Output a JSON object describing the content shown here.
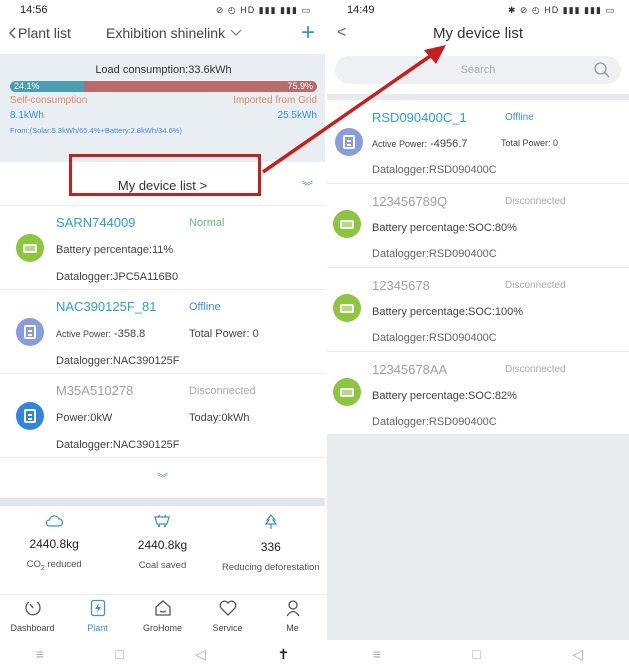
{
  "left": {
    "status_time": "14:56",
    "status_icons": "⊘ ◴ HD ▮▮▮ ▮▮▮ ▭",
    "back_label": "Plant list",
    "plant_name": "Exhibition shinelink",
    "plus": "+",
    "load": {
      "title": "Load consumption:33.6kWh",
      "self_pct": "24.1%",
      "grid_pct": "75.9%",
      "self_label": "Self-consumption",
      "grid_label": "Imported from Grid",
      "self_value": "8.1kWh",
      "grid_value": "25.5kWh",
      "from": "From:(Solar:5.3kWh/65.4%+Battery:2.8kWh/34.6%)",
      "bar_fraction_self": 0.241
    },
    "my_device_list": "My device list >",
    "devices": [
      {
        "name": "SARN744009",
        "status": "Normal",
        "status_color": "#5cc070",
        "icon": "battery-icon",
        "line1": "Battery percentage:11%",
        "line1b": "",
        "line2": "Datalogger:JPC5A116B0"
      },
      {
        "name": "NAC390125F_81",
        "status": "Offline",
        "status_color": "#3a8ee6",
        "icon": "inverter-icon",
        "line1_label": "Active Power:",
        "line1_value": "-358.8",
        "line1b": "Total Power: 0",
        "line2": "Datalogger:NAC390125F"
      },
      {
        "name": "M35A510278",
        "status": "Disconnected",
        "status_color": "#aaaaaa",
        "icon": "meter-icon",
        "line1": "Power:0kW",
        "line1b": "Today:0kWh",
        "line2": "Datalogger:NAC390125F"
      }
    ],
    "eco": [
      {
        "value": "2440.8kg",
        "label_main": "CO",
        "label_sub": "2",
        "label_rest": " reduced"
      },
      {
        "value": "2440.8kg",
        "label": "Coal saved"
      },
      {
        "value": "336",
        "label": "Reducing deforestation"
      }
    ],
    "tabs": [
      "Dashboard",
      "Plant",
      "GroHome",
      "Service",
      "Me"
    ],
    "nav": [
      "≡",
      "□",
      "◁",
      "✝"
    ]
  },
  "right": {
    "status_time": "14:49",
    "status_icons": "✱ ⊘ ◴ HD ▮▮▮ ▮▮▮ ▭",
    "title": "My device list",
    "back": "<",
    "search_placeholder": "Search",
    "devices": [
      {
        "name": "RSD090400C_1",
        "status": "Offline",
        "status_color": "#3a8ee6",
        "icon": "inverter-icon",
        "line1_label": "Active Power:",
        "line1_value": "-4956.7",
        "line1b": "Total Power: 0",
        "line2": "Datalogger:RSD090400C"
      },
      {
        "name": "123456789Q",
        "status": "Disconnected",
        "status_color": "#aaaaaa",
        "icon": "battery-icon",
        "line1": "Battery percentage:SOC:80%",
        "line2": "Datalogger:RSD090400C"
      },
      {
        "name": "12345678",
        "status": "Disconnected",
        "status_color": "#aaaaaa",
        "icon": "battery-icon",
        "line1": "Battery percentage:SOC:100%",
        "line2": "Datalogger:RSD090400C"
      },
      {
        "name": "12345678AA",
        "status": "Disconnected",
        "status_color": "#aaaaaa",
        "icon": "battery-icon",
        "line1": "Battery percentage:SOC:82%",
        "line2": "Datalogger:RSD090400C"
      }
    ],
    "nav": [
      "≡",
      "□",
      "◁"
    ]
  },
  "colors": {
    "accent": "#3a8ee6",
    "highlight": "#c81e1e",
    "battery": "#8cc63f",
    "inverter": "#8a9ce0"
  }
}
